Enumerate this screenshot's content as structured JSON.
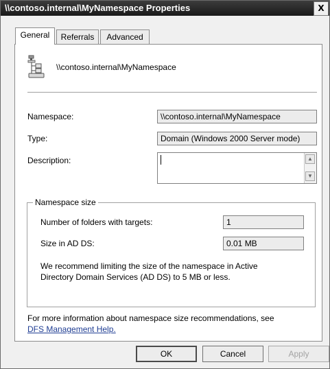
{
  "window": {
    "title": "\\\\contoso.internal\\MyNamespace Properties",
    "close_glyph": "X"
  },
  "tabs": [
    {
      "label": "General",
      "active": true
    },
    {
      "label": "Referrals",
      "active": false
    },
    {
      "label": "Advanced",
      "active": false
    }
  ],
  "header": {
    "icon": "namespace-icon",
    "path": "\\\\contoso.internal\\MyNamespace"
  },
  "fields": {
    "namespace_label": "Namespace:",
    "namespace_value": "\\\\contoso.internal\\MyNamespace",
    "type_label": "Type:",
    "type_value": "Domain (Windows 2000 Server mode)",
    "description_label": "Description:",
    "description_value": ""
  },
  "namespace_size": {
    "legend": "Namespace size",
    "folders_label": "Number of folders with targets:",
    "folders_value": "1",
    "size_label": "Size in AD DS:",
    "size_value": "0.01 MB",
    "recommend_line1": "We recommend limiting the size of the namespace in Active",
    "recommend_line2": "Directory Domain Services (AD DS) to 5 MB or less."
  },
  "footer": {
    "info_text": "For more information about namespace size recommendations, see",
    "help_link": "DFS Management Help."
  },
  "buttons": {
    "ok": "OK",
    "cancel": "Cancel",
    "apply": "Apply",
    "apply_enabled": false
  }
}
